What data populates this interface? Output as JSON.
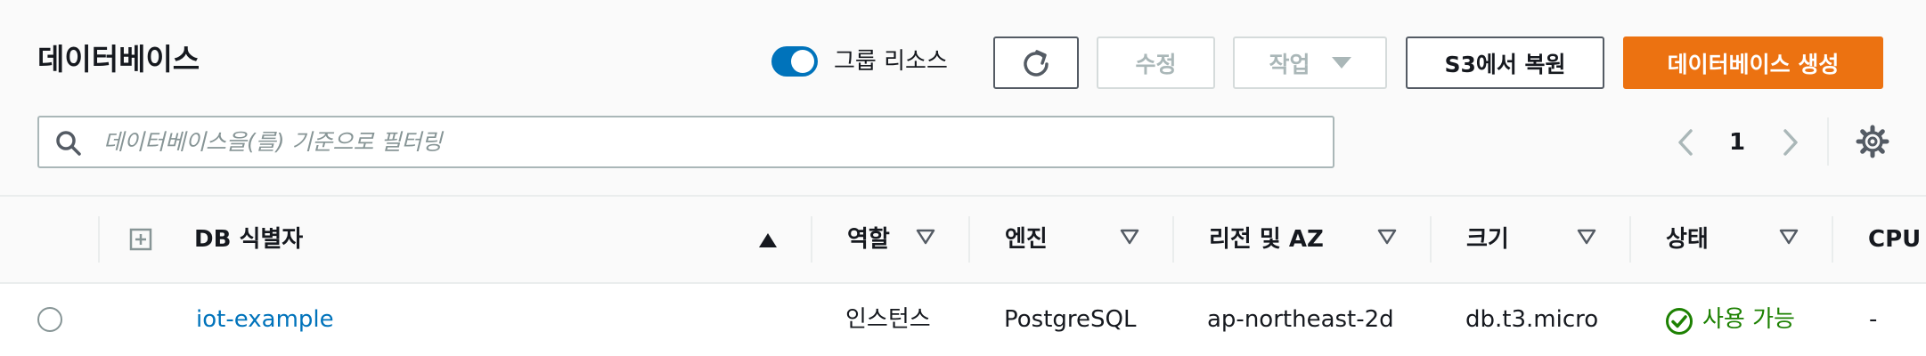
{
  "page": {
    "title": "데이터베이스"
  },
  "toolbar": {
    "group_toggle_label": "그룹 리소스",
    "group_toggle_on": true,
    "edit_label": "수정",
    "actions_label": "작업",
    "restore_label": "S3에서 복원",
    "create_label": "데이터베이스 생성"
  },
  "search": {
    "placeholder": "데이터베이스을(를) 기준으로 필터링",
    "value": ""
  },
  "pagination": {
    "current_page": "1"
  },
  "table": {
    "headers": {
      "identifier": "DB 식별자",
      "role": "역할",
      "engine": "엔진",
      "region": "리전 및 AZ",
      "size": "크기",
      "status": "상태",
      "cpu": "CPU"
    },
    "rows": [
      {
        "identifier": "iot-example",
        "role": "인스턴스",
        "engine": "PostgreSQL",
        "region": "ap-northeast-2d",
        "size": "db.t3.micro",
        "status": "사용 가능",
        "cpu": "-"
      }
    ]
  },
  "colors": {
    "accent": "#0073bb",
    "primary_button": "#ec7211",
    "status_available": "#1d8102",
    "disabled": "#aab7b8"
  },
  "icons": [
    "refresh-icon",
    "caret-down-icon",
    "search-icon",
    "chevron-left-icon",
    "chevron-right-icon",
    "gear-icon",
    "expand-all-icon",
    "sort-ascending-icon",
    "filter-icon",
    "status-ok-icon"
  ]
}
